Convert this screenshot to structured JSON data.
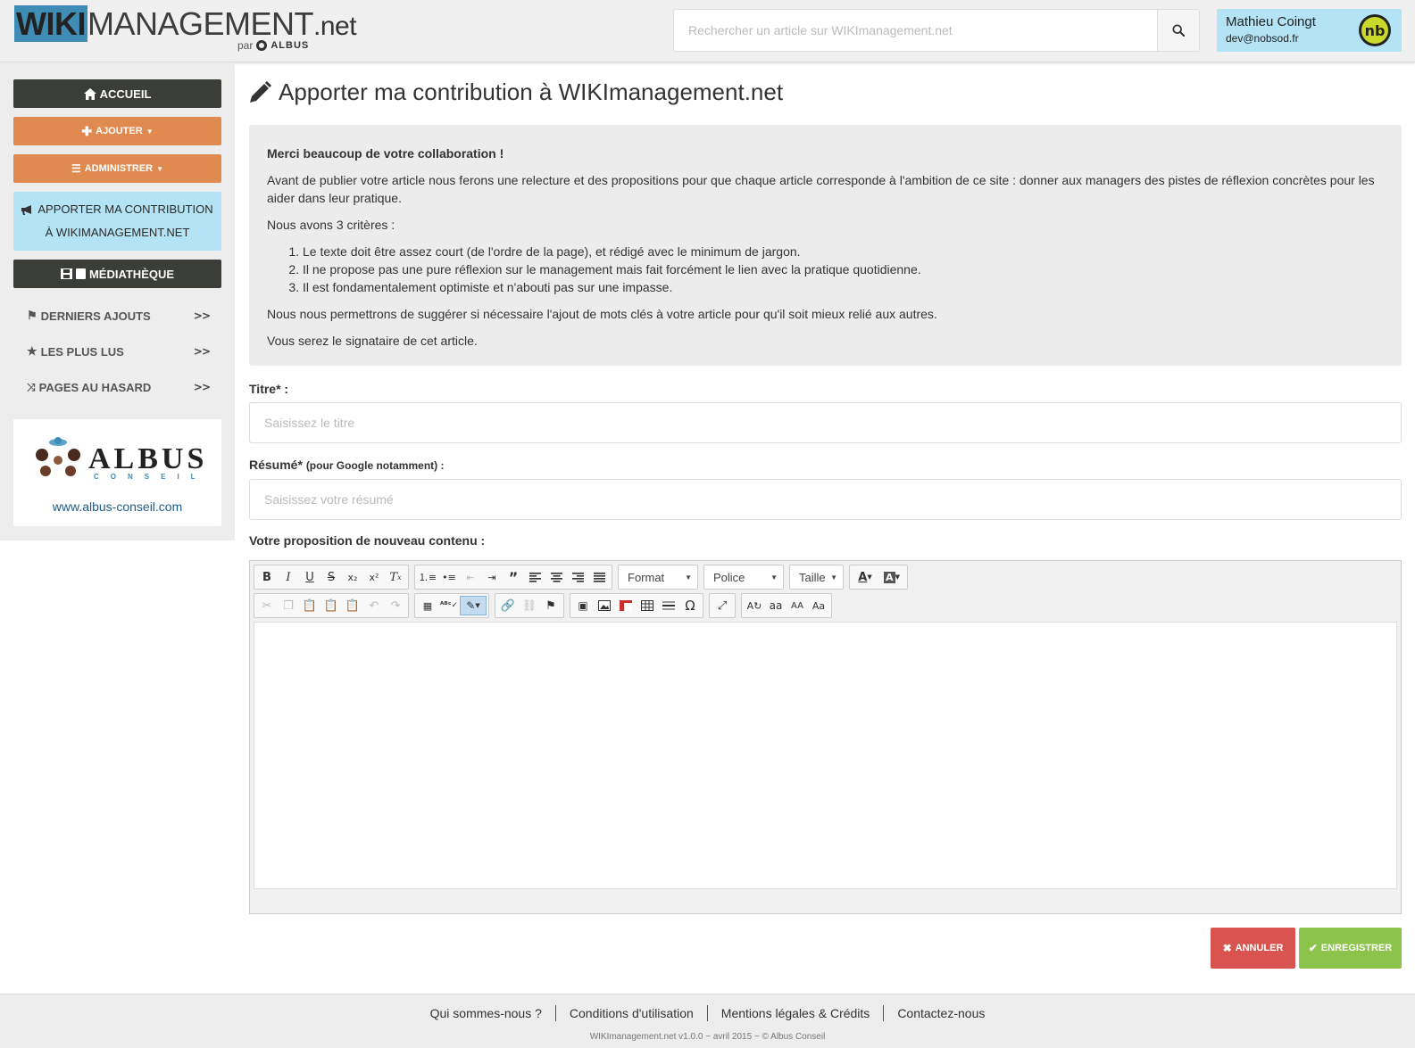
{
  "header": {
    "logo": {
      "part1": "WIKI",
      "part2": "MANAGEMENT",
      "part3": ".net",
      "sub_prefix": "par",
      "sub_brand": "ALBUS"
    },
    "search": {
      "placeholder": "Rechercher un article sur WIKImanagement.net",
      "value": "",
      "icon": "search-icon"
    },
    "user": {
      "name": "Mathieu Coingt",
      "email": "dev@nobsod.fr",
      "avatar_text": "nb"
    }
  },
  "sidebar": {
    "home": {
      "label": "ACCUEIL",
      "icon": "home-icon"
    },
    "add": {
      "label": "AJOUTER",
      "icon": "plus-icon"
    },
    "admin": {
      "label": "ADMINISTRER",
      "icon": "list-icon"
    },
    "contribute": {
      "line1": "APPORTER MA CONTRIBUTION",
      "line2": "À WIKIMANAGEMENT.NET",
      "icon": "bullhorn-icon"
    },
    "media": {
      "label": "MÉDIATHÈQUE",
      "icon": "film-icon"
    },
    "links": [
      {
        "label": "DERNIERS AJOUTS",
        "icon": "flag-icon",
        "arrow": ">>"
      },
      {
        "label": "LES PLUS LUS",
        "icon": "star-icon",
        "arrow": ">>"
      },
      {
        "label": "PAGES AU HASARD",
        "icon": "shuffle-icon",
        "arrow": ">>"
      }
    ],
    "partner": {
      "brand": "ALBUS",
      "sub": "CONSEIL",
      "url": "www.albus-conseil.com"
    }
  },
  "main": {
    "title": "Apporter ma contribution à WIKImanagement.net",
    "info": {
      "intro": "Merci beaucoup de votre collaboration !",
      "p1": "Avant de publier votre article nous ferons une relecture et des propositions pour que chaque article corresponde à l'ambition de ce site : donner aux managers des pistes de réflexion concrètes pour les aider dans leur pratique.",
      "p2": "Nous avons 3 critères :",
      "criteria": [
        "Le texte doit être assez court (de l'ordre de la page), et rédigé avec le minimum de jargon.",
        "Il ne propose pas une pure réflexion sur le management mais fait forcément le lien avec la pratique quotidienne.",
        "Il est fondamentalement optimiste et n'abouti pas sur une impasse."
      ],
      "p3": "Nous nous permettrons de suggérer si nécessaire l'ajout de mots clés à votre article pour qu'il soit mieux relié aux autres.",
      "p4": "Vous serez le signataire de cet article."
    },
    "form": {
      "title_label": "Titre* :",
      "title_placeholder": "Saisissez le titre",
      "summary_label": "Résumé*",
      "summary_note": "(pour Google notamment) :",
      "summary_placeholder": "Saisissez votre résumé",
      "content_label": "Votre proposition de nouveau contenu :"
    },
    "editor": {
      "combo_format": "Format",
      "combo_font": "Police",
      "combo_size": "Taille"
    },
    "actions": {
      "cancel": "ANNULER",
      "save": "ENREGISTRER"
    }
  },
  "footer": {
    "links": [
      "Qui sommes-nous ?",
      "Conditions d'utilisation",
      "Mentions légales & Crédits",
      "Contactez-nous"
    ],
    "copyright": "WIKImanagement.net v1.0.0 ~ avril 2015 ~ © Albus Conseil"
  }
}
